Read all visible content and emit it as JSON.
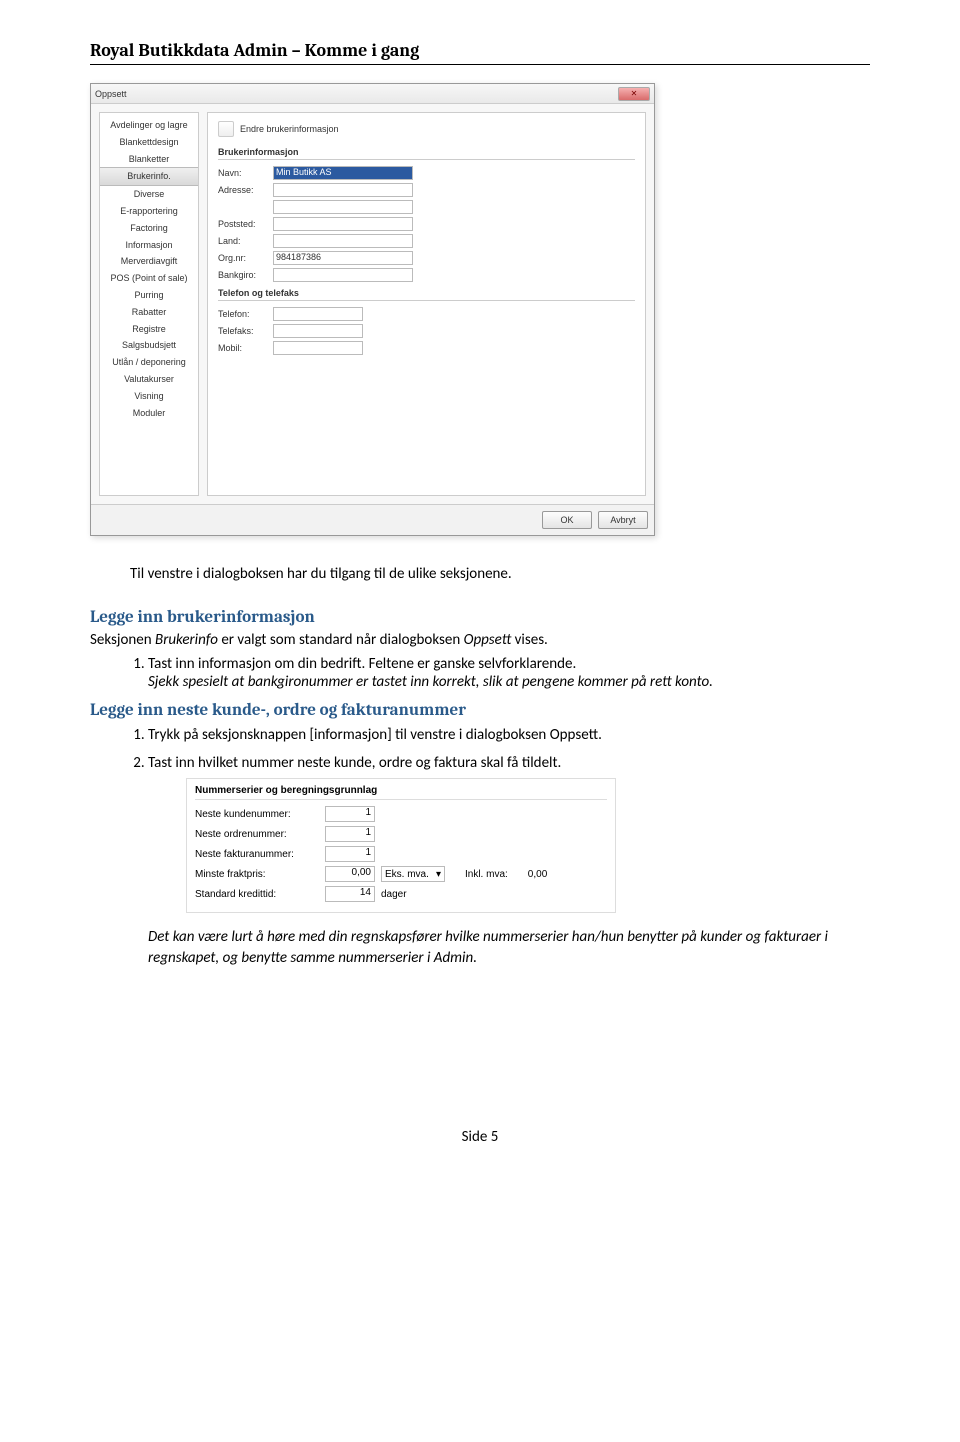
{
  "header": "Royal Butikkdata Admin – Komme i gang",
  "dialog": {
    "title": "Oppsett",
    "close_glyph": "✕",
    "sidebar": {
      "items": [
        "Avdelinger og lagre",
        "Blankettdesign",
        "Blanketter",
        "Brukerinfo.",
        "Diverse",
        "E-rapportering",
        "Factoring",
        "Informasjon",
        "Merverdiavgift",
        "POS (Point of sale)",
        "Purring",
        "Rabatter",
        "Registre",
        "Salgsbudsjett",
        "Utlån / deponering",
        "Valutakurser",
        "Visning",
        "Moduler"
      ],
      "selected_index": 3
    },
    "main": {
      "title": "Endre brukerinformasjon",
      "group1_label": "Brukerinformasjon",
      "group2_label": "Telefon og telefaks",
      "fields": {
        "navn_label": "Navn:",
        "navn_value": "Min Butikk AS",
        "adresse_label": "Adresse:",
        "poststed_label": "Poststed:",
        "land_label": "Land:",
        "orgnr_label": "Org.nr:",
        "orgnr_value": "984187386",
        "bankgiro_label": "Bankgiro:",
        "telefon_label": "Telefon:",
        "telefaks_label": "Telefaks:",
        "mobil_label": "Mobil:"
      }
    },
    "footer": {
      "ok": "OK",
      "cancel": "Avbryt"
    }
  },
  "text1": "Til venstre i dialogboksen har du tilgang til de ulike seksjonene.",
  "sec1": {
    "title": "Legge inn brukerinformasjon",
    "intro_a": "Seksjonen ",
    "intro_b": "Brukerinfo",
    "intro_c": " er valgt som standard når dialogboksen ",
    "intro_d": "Oppsett",
    "intro_e": " vises.",
    "li1a": "Tast inn informasjon om din bedrift. Feltene er ganske selvforklarende.",
    "li1b": "Sjekk spesielt at bankgironummer er tastet inn korrekt, slik at pengene kommer på rett konto."
  },
  "sec2": {
    "title": "Legge inn neste kunde-, ordre og fakturanummer",
    "li1": "Trykk på seksjonsknappen [informasjon] til venstre i dialogboksen Oppsett.",
    "li2": "Tast inn hvilket nummer neste kunde, ordre og faktura skal få tildelt."
  },
  "snap2": {
    "legend": "Nummerserier og beregningsgrunnlag",
    "f_kunde_label": "Neste kundenummer:",
    "f_kunde_val": "1",
    "f_ordre_label": "Neste ordrenummer:",
    "f_ordre_val": "1",
    "f_fakt_label": "Neste fakturanummer:",
    "f_fakt_val": "1",
    "f_frakt_label": "Minste fraktpris:",
    "f_frakt_val": "0,00",
    "combo_label": "Eks. mva.",
    "inkl_label": "Inkl. mva:",
    "inkl_val": "0,00",
    "f_kred_label": "Standard kredittid:",
    "f_kred_val": "14",
    "f_kred_suffix": "dager"
  },
  "closing": "Det kan være lurt å høre med din regnskapsfører hvilke nummerserier han/hun benytter på kunder og fakturaer i regnskapet, og benytte samme nummerserier i Admin.",
  "footer": "Side 5"
}
